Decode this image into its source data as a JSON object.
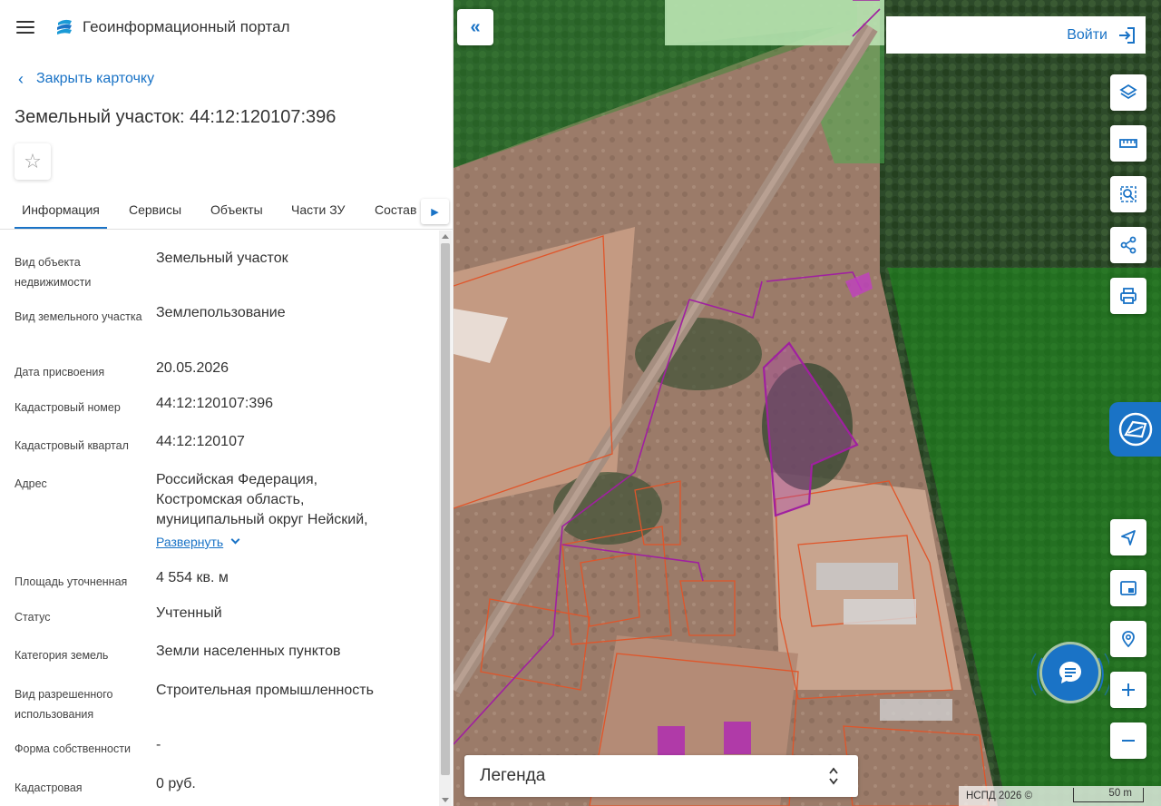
{
  "header": {
    "portal_title": "Геоинформационный портал"
  },
  "card": {
    "close_label": "Закрыть карточку",
    "title": "Земельный участок: 44:12:120107:396"
  },
  "tabs": [
    {
      "label": "Информация",
      "active": true
    },
    {
      "label": "Сервисы",
      "active": false
    },
    {
      "label": "Объекты",
      "active": false
    },
    {
      "label": "Части ЗУ",
      "active": false
    },
    {
      "label": "Состав",
      "active": false
    }
  ],
  "info": {
    "object_type": {
      "label": "Вид объекта недвижимости",
      "value": "Земельный участок"
    },
    "land_type": {
      "label": "Вид земельного участка",
      "value": "Землепользование"
    },
    "assigned_date": {
      "label": "Дата присвоения",
      "value": "20.05.2026"
    },
    "cadastral_number": {
      "label": "Кадастровый номер",
      "value": "44:12:120107:396"
    },
    "cadastral_quarter": {
      "label": "Кадастровый квартал",
      "value": "44:12:120107"
    },
    "address": {
      "label": "Адрес",
      "lines": [
        "Российская Федерация,",
        "Костромская область,",
        "муниципальный округ Нейский,"
      ],
      "expand_label": "Развернуть"
    },
    "area": {
      "label": "Площадь уточненная",
      "value": "4 554 кв. м"
    },
    "status": {
      "label": "Статус",
      "value": "Учтенный"
    },
    "land_category": {
      "label": "Категория земель",
      "value": "Земли населенных пунктов"
    },
    "permitted_use": {
      "label": "Вид разрешенного использования",
      "value": "Строительная промышленность"
    },
    "ownership": {
      "label": "Форма собственности",
      "value": "-"
    },
    "cadastral_value": {
      "label": "Кадастровая",
      "value": "0 руб."
    }
  },
  "map": {
    "login_label": "Войти",
    "legend_label": "Легенда",
    "copyright": "НСПД 2026 ©",
    "scale_label": "50 m"
  },
  "colors": {
    "accent": "#1a73c6",
    "parcel_outline": "#a020a0",
    "parcel_border_orange": "#e0552a",
    "forest_overlay": "#2e8b2e"
  },
  "icons": {
    "menu": "hamburger-icon",
    "logo": "portal-logo-icon",
    "favorite": "star-icon",
    "layers": "layers-icon",
    "ruler": "ruler-icon",
    "search_area": "area-search-icon",
    "share": "share-icon",
    "print": "print-icon",
    "locate": "navigation-arrow-icon",
    "minimap": "picture-in-picture-icon",
    "geolocation": "location-pin-icon",
    "zoom_in": "plus-icon",
    "zoom_out": "minus-icon",
    "chat": "chat-bubble-icon"
  }
}
